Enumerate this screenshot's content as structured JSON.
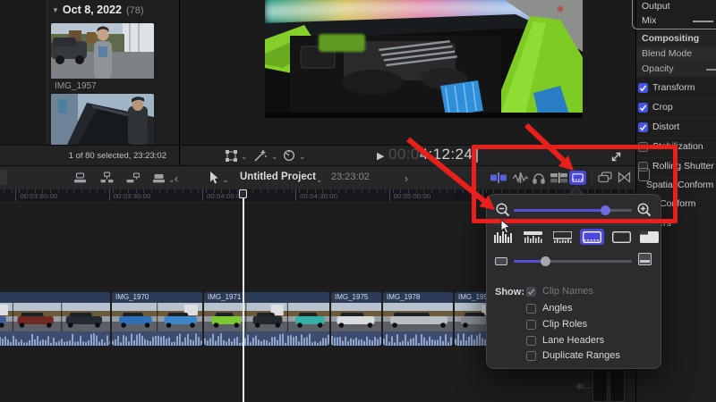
{
  "colors": {
    "accent": "#4b49dc",
    "annotation": "#e8201b",
    "checkbox": "#4454e4",
    "clip_name_bar": "#2c3b58"
  },
  "icons": {
    "disclosure": "▼",
    "chev_down": "⌄",
    "chev_left": "‹",
    "chev_right": "›",
    "play": "▶"
  },
  "browser": {
    "title": "Oct 8, 2022",
    "count": "(78)",
    "items": [
      {
        "label": "IMG_1957"
      }
    ],
    "status": "1 of 80 selected, 23:23:02"
  },
  "viewer": {
    "timecode_dim": "00:0",
    "timecode_bright": "4:12:24"
  },
  "toolbar": {
    "project_name": "Untitled Project",
    "project_time": "23:23:02"
  },
  "ruler_labels": [
    "00:03:00:00",
    "00:03:30:00",
    "00:04:00:00",
    "00:04:30:00",
    "00:05:00:00"
  ],
  "timeline": {
    "clips": [
      {
        "name": ""
      },
      {
        "name": "IMG_1970"
      },
      {
        "name": "IMG_1971"
      },
      {
        "name": "IMG_1975"
      },
      {
        "name": "IMG_1978"
      },
      {
        "name": "IMG_199"
      }
    ]
  },
  "inspector": {
    "output": "Output",
    "mix": "Mix",
    "compositing": "Compositing",
    "blend_mode": "Blend Mode",
    "opacity": "Opacity",
    "toggles": [
      {
        "label": "Transform",
        "checked": true
      },
      {
        "label": "Crop",
        "checked": true
      },
      {
        "label": "Distort",
        "checked": true
      },
      {
        "label": "Stabilization",
        "checked": false
      },
      {
        "label": "Rolling Shutter",
        "checked": false
      }
    ],
    "spatial_conform": "Spatial Conform",
    "rate_conform": "Rate Conform",
    "markers": "Markers"
  },
  "popover": {
    "zoom_value": 78,
    "height_value": 27,
    "selected_style_index": 3,
    "show_label": "Show:",
    "options": [
      {
        "label": "Clip Names",
        "checked": true,
        "disabled": true
      },
      {
        "label": "Angles",
        "checked": false
      },
      {
        "label": "Clip Roles",
        "checked": false
      },
      {
        "label": "Lane Headers",
        "checked": false
      },
      {
        "label": "Duplicate Ranges",
        "checked": false
      }
    ]
  },
  "meters": {
    "label": "-30"
  }
}
